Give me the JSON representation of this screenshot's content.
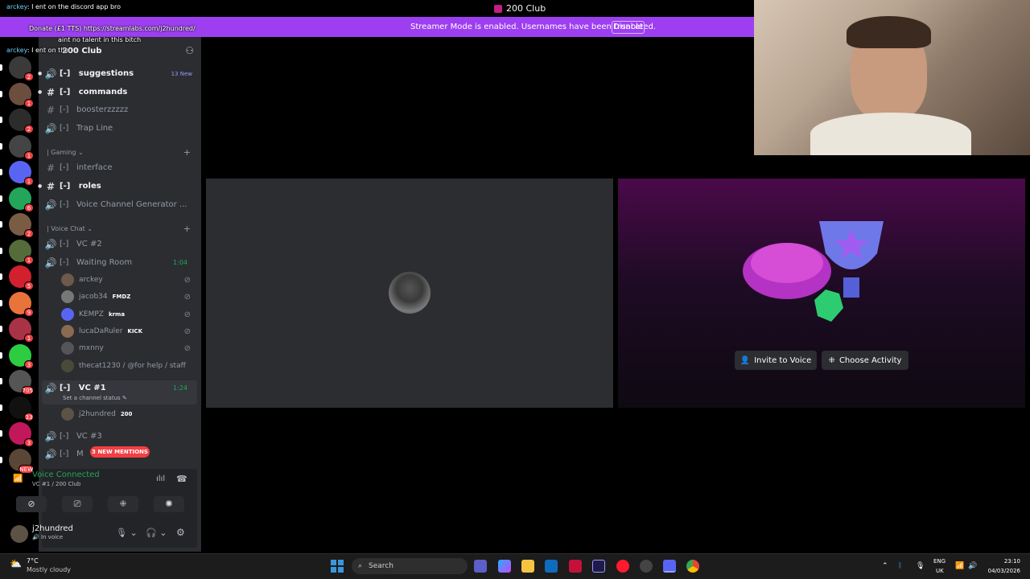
{
  "window": {
    "title": "200 Club"
  },
  "streamer_banner": {
    "text": "Streamer Mode is enabled. Usernames have been truncated.",
    "button": "Disable"
  },
  "overlay_chat": [
    {
      "user": "arckey",
      "text": "I ent on the discord app bro"
    },
    {
      "user": "",
      "text": "Donate (£1 TTS) https://streamlabs.com/j2hundred/"
    },
    {
      "user": "",
      "text": "aint no talent in this bitch"
    },
    {
      "user": "arckey",
      "text": "I ent on the"
    }
  ],
  "server_name": "200 Club",
  "servers": [
    {
      "badge": "2",
      "color": "#3a3a3a"
    },
    {
      "badge": "1",
      "color": "#6b4e3d"
    },
    {
      "badge": "2",
      "color": "#2c2c2c"
    },
    {
      "badge": "1",
      "color": "#444444"
    },
    {
      "badge": "1",
      "color": "#5865f2"
    },
    {
      "badge": "6",
      "color": "#23a55a"
    },
    {
      "badge": "2",
      "color": "#7a5b44"
    },
    {
      "badge": "1",
      "color": "#556b3a"
    },
    {
      "badge": "5",
      "color": "#d1202e"
    },
    {
      "badge": "9",
      "color": "#e8743b"
    },
    {
      "badge": "1",
      "color": "#a83246"
    },
    {
      "badge": "3",
      "color": "#2ecc40"
    },
    {
      "badge": "705",
      "color": "#555555"
    },
    {
      "badge": "33",
      "color": "#111111"
    },
    {
      "badge": "3",
      "color": "#c2185b"
    },
    {
      "badge": "NEW",
      "color": "#5a4636"
    }
  ],
  "channels": [
    {
      "icon": "voice",
      "name": "suggestions",
      "unread": true,
      "extra": "13 New"
    },
    {
      "icon": "text",
      "name": "commands",
      "unread": true
    },
    {
      "icon": "text",
      "name": "boosterzzzzz",
      "unread": false
    },
    {
      "icon": "voice",
      "name": "Trap Line",
      "unread": false
    }
  ],
  "category_gaming": "| Gaming",
  "gaming_channels": [
    {
      "icon": "text",
      "name": "interface",
      "unread": false
    },
    {
      "icon": "text",
      "name": "roles",
      "unread": true
    },
    {
      "icon": "voice",
      "name": "Voice Channel Generator ...",
      "unread": false
    }
  ],
  "category_voice": "| Voice Chat",
  "channel_prefix": "[-]",
  "vc2": "VC #2",
  "waiting_room": {
    "name": "Waiting Room",
    "timer": "1:04"
  },
  "waiting_users": [
    {
      "name": "arckey",
      "tag": ""
    },
    {
      "name": "jacob34",
      "tag": "FMDZ"
    },
    {
      "name": "KEMPZ",
      "tag": "krma"
    },
    {
      "name": "lucaDaRuler",
      "tag": "KICK"
    },
    {
      "name": "mxnny",
      "tag": ""
    },
    {
      "name": "thecat1230 / @for help / staff",
      "tag": ""
    }
  ],
  "vc1": {
    "name": "VC #1",
    "timer": "1:24",
    "status": "Set a channel status"
  },
  "vc1_users": [
    {
      "name": "j2hundred",
      "tag": "200"
    }
  ],
  "vc3": "VC #3",
  "last_channel": "M",
  "mentions": "3 NEW MENTIONS",
  "voice_panel": {
    "status": "Voice Connected",
    "sub": "VC #1 / 200 Club"
  },
  "user": {
    "name": "j2hundred",
    "status": "In voice"
  },
  "stage_buttons": {
    "invite": "Invite to Voice",
    "activity": "Choose Activity"
  },
  "taskbar": {
    "temp": "7°C",
    "weather": "Mostly cloudy",
    "search": "Search",
    "lang1": "ENG",
    "lang2": "UK",
    "time": "23:10",
    "date": "04/03/2026"
  }
}
